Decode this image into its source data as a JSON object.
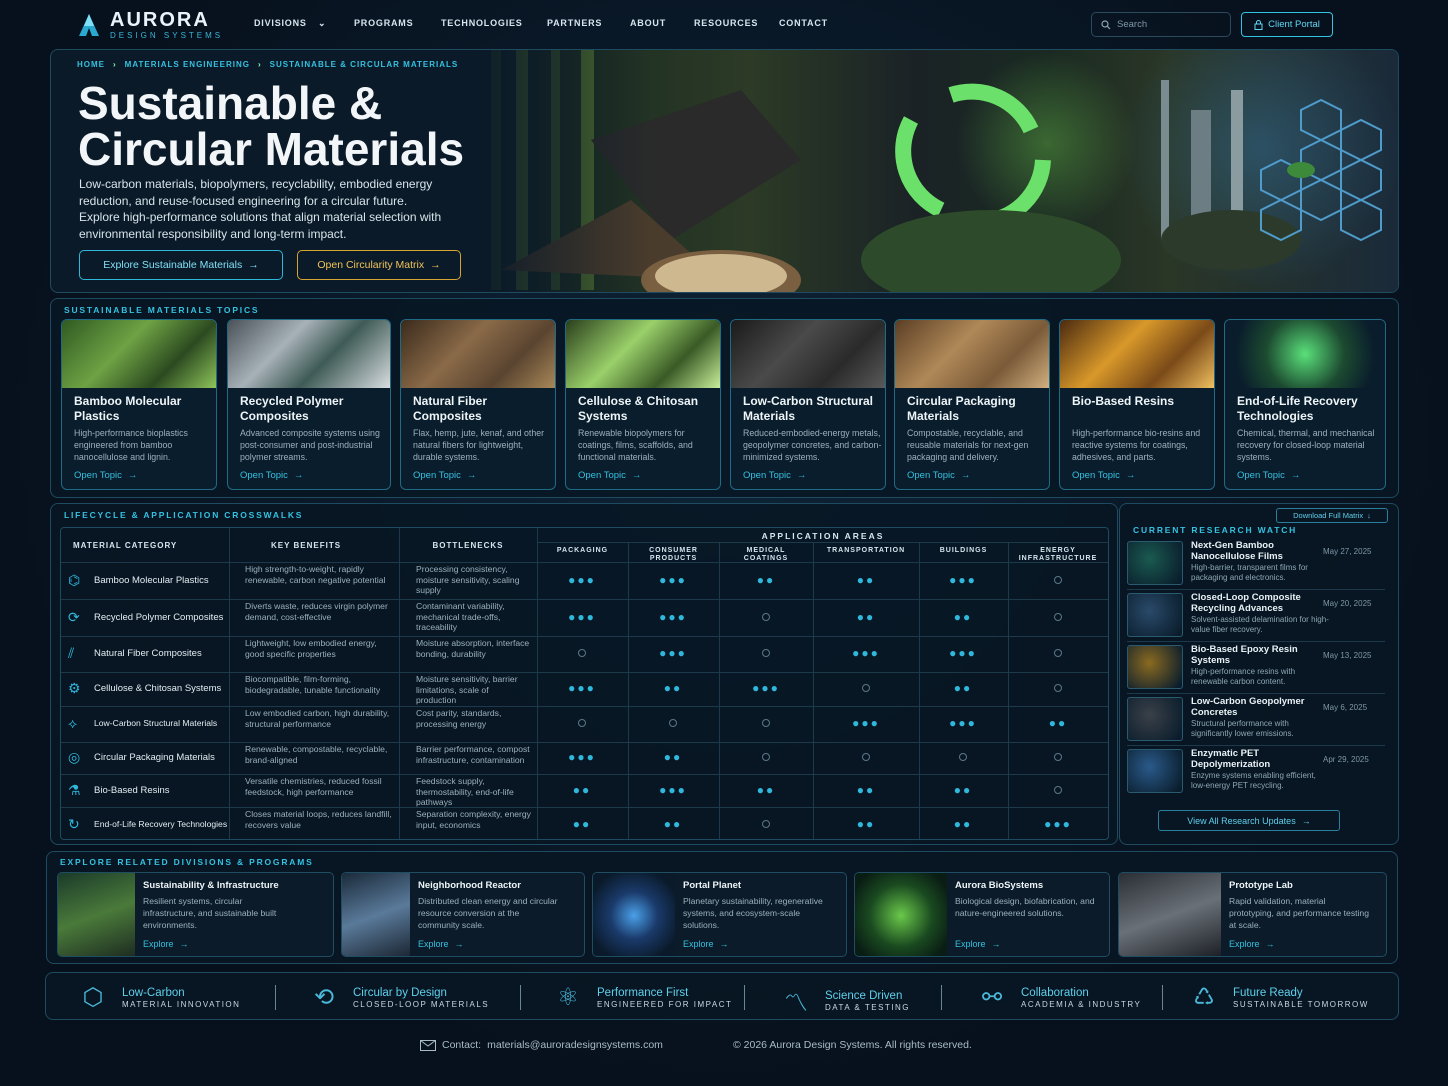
{
  "brand": {
    "name": "AURORA",
    "sub": "DESIGN SYSTEMS"
  },
  "nav": {
    "items": [
      "DIVISIONS",
      "PROGRAMS",
      "TECHNOLOGIES",
      "PARTNERS",
      "ABOUT",
      "RESOURCES",
      "CONTACT"
    ],
    "search_placeholder": "Search",
    "portal": "Client Portal"
  },
  "hero": {
    "crumbs": [
      "HOME",
      "MATERIALS ENGINEERING",
      "SUSTAINABLE & CIRCULAR MATERIALS"
    ],
    "title_line1": "Sustainable &",
    "title_line2": "Circular Materials",
    "description": "Low-carbon materials, biopolymers, recyclability, embodied energy reduction, and reuse-focused engineering for a circular future. Explore high-performance solutions that align material selection with environmental responsibility and long-term impact.",
    "btn_primary": "Explore Sustainable Materials",
    "btn_secondary": "Open Circularity Matrix"
  },
  "topics": {
    "title": "SUSTAINABLE MATERIALS TOPICS",
    "link": "Open Topic",
    "cards": [
      {
        "title": "Bamboo Molecular Plastics",
        "desc": "High-performance bioplastics engineered from bamboo nanocellulose and lignin."
      },
      {
        "title": "Recycled Polymer Composites",
        "desc": "Advanced composite systems using post-consumer and post-industrial polymer streams."
      },
      {
        "title": "Natural Fiber Composites",
        "desc": "Flax, hemp, jute, kenaf, and other natural fibers for lightweight, durable systems."
      },
      {
        "title": "Cellulose & Chitosan Systems",
        "desc": "Renewable biopolymers for coatings, films, scaffolds, and functional materials."
      },
      {
        "title": "Low-Carbon Structural Materials",
        "desc": "Reduced-embodied-energy metals, geopolymer concretes, and carbon-minimized systems."
      },
      {
        "title": "Circular Packaging Materials",
        "desc": "Compostable, recyclable, and reusable materials for next-gen packaging and delivery."
      },
      {
        "title": "Bio-Based Resins",
        "desc": "High-performance bio-resins and reactive systems for coatings, adhesives, and parts."
      },
      {
        "title": "End-of-Life Recovery Technologies",
        "desc": "Chemical, thermal, and mechanical recovery for closed-loop material systems."
      }
    ]
  },
  "lifecycle": {
    "title": "LIFECYCLE & APPLICATION CROSSWALKS",
    "headers": {
      "category": "MATERIAL CATEGORY",
      "benefits": "KEY BENEFITS",
      "bottlenecks": "BOTTLENECKS",
      "areas": "APPLICATION AREAS"
    },
    "areas": [
      "PACKAGING",
      "CONSUMER PRODUCTS",
      "MEDICAL COATINGS",
      "TRANSPORTATION",
      "BUILDINGS",
      "ENERGY INFRASTRUCTURE"
    ],
    "rows": [
      {
        "name": "Bamboo Molecular Plastics",
        "benefits": "High strength-to-weight, rapidly renewable, carbon negative potential",
        "bottlenecks": "Processing consistency, moisture sensitivity, scaling supply",
        "levels": [
          3,
          3,
          2,
          2,
          3,
          0
        ]
      },
      {
        "name": "Recycled Polymer Composites",
        "benefits": "Diverts waste, reduces virgin polymer demand, cost-effective",
        "bottlenecks": "Contaminant variability, mechanical trade-offs, traceability",
        "levels": [
          3,
          3,
          0,
          2,
          2,
          0
        ]
      },
      {
        "name": "Natural Fiber Composites",
        "benefits": "Lightweight, low embodied energy, good specific properties",
        "bottlenecks": "Moisture absorption, interface bonding, durability",
        "levels": [
          0,
          3,
          0,
          3,
          3,
          0
        ]
      },
      {
        "name": "Cellulose & Chitosan Systems",
        "benefits": "Biocompatible, film-forming, biodegradable, tunable functionality",
        "bottlenecks": "Moisture sensitivity, barrier limitations, scale of production",
        "levels": [
          3,
          2,
          3,
          0,
          2,
          0
        ]
      },
      {
        "name": "Low-Carbon Structural Materials",
        "benefits": "Low embodied carbon, high durability, structural performance",
        "bottlenecks": "Cost parity, standards, processing energy",
        "levels": [
          0,
          0,
          0,
          3,
          3,
          2
        ]
      },
      {
        "name": "Circular Packaging Materials",
        "benefits": "Renewable, compostable, recyclable, brand-aligned",
        "bottlenecks": "Barrier performance, compost infrastructure, contamination",
        "levels": [
          3,
          2,
          0,
          0,
          0,
          0
        ]
      },
      {
        "name": "Bio-Based Resins",
        "benefits": "Versatile chemistries, reduced fossil feedstock, high performance",
        "bottlenecks": "Feedstock supply, thermostability, end-of-life pathways",
        "levels": [
          2,
          3,
          2,
          2,
          2,
          0
        ]
      },
      {
        "name": "End-of-Life Recovery Technologies",
        "benefits": "Closes material loops, reduces landfill, recovers value",
        "bottlenecks": "Separation complexity, energy input, economics",
        "levels": [
          2,
          2,
          0,
          2,
          2,
          3
        ]
      }
    ]
  },
  "research": {
    "title": "CURRENT RESEARCH WATCH",
    "download": "Download Full Matrix",
    "view_all": "View All Research Updates",
    "items": [
      {
        "title": "Next-Gen Bamboo Nanocellulose Films",
        "desc": "High-barrier, transparent films for packaging and electronics.",
        "date": "May 27, 2025"
      },
      {
        "title": "Closed-Loop Composite Recycling Advances",
        "desc": "Solvent-assisted delamination for high-value fiber recovery.",
        "date": "May 20, 2025"
      },
      {
        "title": "Bio-Based Epoxy Resin Systems",
        "desc": "High-performance resins with renewable carbon content.",
        "date": "May 13, 2025"
      },
      {
        "title": "Low-Carbon Geopolymer Concretes",
        "desc": "Structural performance with significantly lower emissions.",
        "date": "May 6, 2025"
      },
      {
        "title": "Enzymatic PET Depolymerization",
        "desc": "Enzyme systems enabling efficient, low-energy PET recycling.",
        "date": "Apr 29, 2025"
      }
    ]
  },
  "related": {
    "title": "EXPLORE RELATED DIVISIONS & PROGRAMS",
    "link": "Explore",
    "items": [
      {
        "title": "Sustainability & Infrastructure",
        "desc": "Resilient systems, circular infrastructure, and sustainable built environments."
      },
      {
        "title": "Neighborhood Reactor",
        "desc": "Distributed clean energy and circular resource conversion at the community scale."
      },
      {
        "title": "Portal Planet",
        "desc": "Planetary sustainability, regenerative systems, and ecosystem-scale solutions."
      },
      {
        "title": "Aurora BioSystems",
        "desc": "Biological design, biofabrication, and nature-engineered solutions."
      },
      {
        "title": "Prototype Lab",
        "desc": "Rapid validation, material prototyping, and performance testing at scale."
      }
    ]
  },
  "features": [
    {
      "title": "Low-Carbon",
      "sub": "MATERIAL INNOVATION"
    },
    {
      "title": "Circular by Design",
      "sub": "CLOSED-LOOP MATERIALS"
    },
    {
      "title": "Performance First",
      "sub": "ENGINEERED FOR IMPACT"
    },
    {
      "title": "Science Driven",
      "sub": "DATA & TESTING"
    },
    {
      "title": "Collaboration",
      "sub": "ACADEMIA & INDUSTRY"
    },
    {
      "title": "Future Ready",
      "sub": "SUSTAINABLE TOMORROW"
    }
  ],
  "footer": {
    "contact_label": "Contact:",
    "email": "materials@auroradesignsystems.com",
    "copyright": "© 2026 Aurora Design Systems. All rights reserved."
  },
  "colors": {
    "accent": "#35c1e0",
    "gold": "#d8a431",
    "bg": "#07111d"
  }
}
